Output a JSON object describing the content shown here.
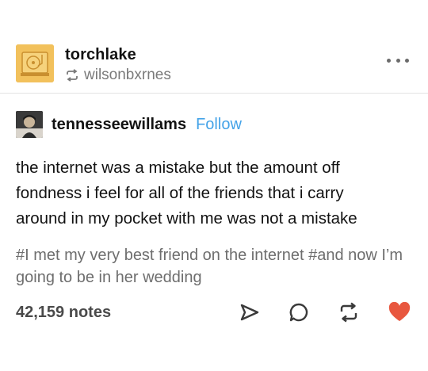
{
  "post": {
    "blog_name": "torchlake",
    "reblogged_from": "wilsonbxrnes",
    "icons": {
      "avatar": "record-player-avatar",
      "reblog_small": "reblog-icon",
      "menu": "more-horizontal-icon"
    }
  },
  "source": {
    "name": "tennesseewillams",
    "follow_label": "Follow",
    "accent_color": "#44a3e8"
  },
  "body": {
    "lines": [
      "the internet was a mistake but the amount off",
      "fondness i feel for all of the friends that i carry",
      "around in my pocket with me was not a mistake"
    ]
  },
  "tags": {
    "items": [
      "#I met my very best friend on the internet",
      "#and now I’m going to be in her wedding"
    ]
  },
  "footer": {
    "notes": "42,159 notes",
    "actions": [
      {
        "icon": "share-icon"
      },
      {
        "icon": "reply-icon"
      },
      {
        "icon": "reblog-icon"
      },
      {
        "icon": "heart-icon",
        "color": "#e8573f"
      }
    ]
  }
}
